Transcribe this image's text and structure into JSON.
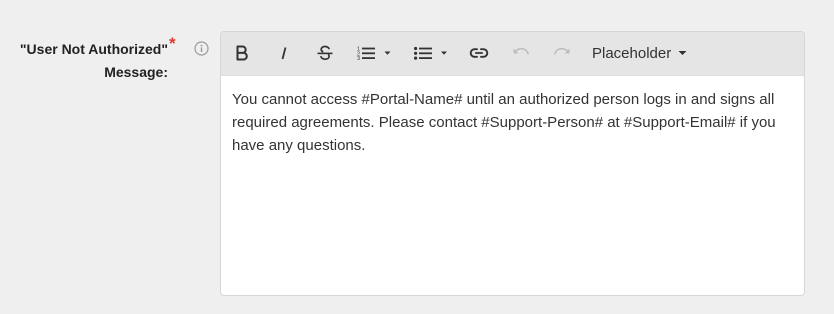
{
  "field": {
    "label_line1": "\"User Not Authorized\"",
    "label_line2": "Message:",
    "required_marker": "*"
  },
  "toolbar": {
    "buttons": [
      {
        "name": "bold-button",
        "icon": "bold-icon"
      },
      {
        "name": "italic-button",
        "icon": "italic-icon"
      },
      {
        "name": "strikethrough-button",
        "icon": "strikethrough-icon"
      },
      {
        "name": "ordered-list-button",
        "icon": "ordered-list-icon"
      },
      {
        "name": "bullet-list-button",
        "icon": "bullet-list-icon"
      },
      {
        "name": "link-button",
        "icon": "link-icon"
      },
      {
        "name": "undo-button",
        "icon": "undo-icon",
        "disabled": true
      },
      {
        "name": "redo-button",
        "icon": "redo-icon",
        "disabled": true
      }
    ],
    "placeholder_label": "Placeholder"
  },
  "editor": {
    "content": "You cannot access #Portal-Name# until an authorized person logs in and signs all required agreements. Please contact #Support-Person# at #Support-Email# if you have any questions."
  },
  "colors": {
    "page_background": "#efefef",
    "toolbar_background": "#e5e5e5",
    "required_star": "#e03b2d",
    "disabled_icon": "#bdbdbd"
  }
}
